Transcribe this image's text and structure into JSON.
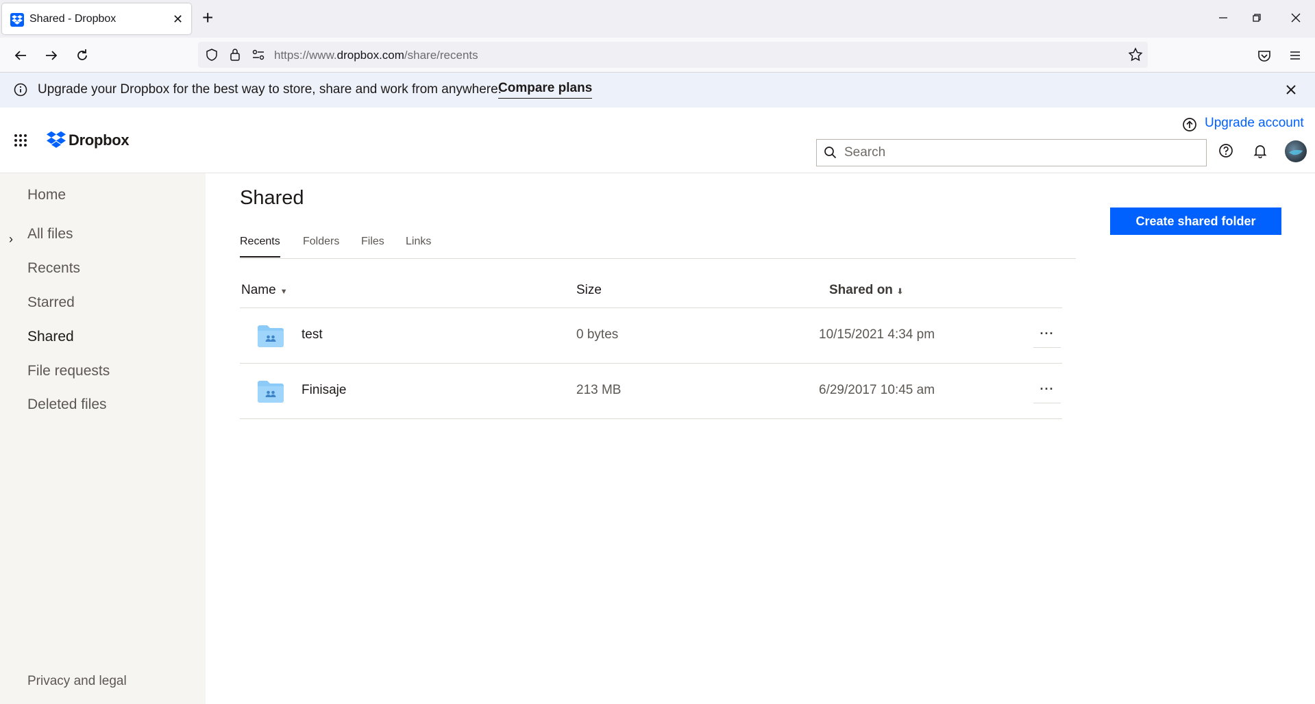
{
  "browser": {
    "tab_title": "Shared - Dropbox",
    "url_prefix": "https://www.",
    "url_domain": "dropbox.com",
    "url_path": "/share/recents"
  },
  "banner": {
    "text": "Upgrade your Dropbox for the best way to store, share and work from anywhere.",
    "link": "Compare plans"
  },
  "header": {
    "logo_text": "Dropbox",
    "upgrade_label": "Upgrade account",
    "search_placeholder": "Search"
  },
  "sidebar": {
    "items": [
      {
        "label": "Home"
      },
      {
        "label": "All files"
      },
      {
        "label": "Recents"
      },
      {
        "label": "Starred"
      },
      {
        "label": "Shared"
      },
      {
        "label": "File requests"
      },
      {
        "label": "Deleted files"
      }
    ],
    "footer": "Privacy and legal"
  },
  "main": {
    "title": "Shared",
    "create_button": "Create shared folder",
    "tabs": [
      {
        "label": "Recents"
      },
      {
        "label": "Folders"
      },
      {
        "label": "Files"
      },
      {
        "label": "Links"
      }
    ],
    "columns": {
      "name": "Name",
      "size": "Size",
      "shared_on": "Shared on"
    },
    "rows": [
      {
        "name": "test",
        "size": "0 bytes",
        "shared_on": "10/15/2021 4:34 pm"
      },
      {
        "name": "Finisaje",
        "size": "213 MB",
        "shared_on": "6/29/2017 10:45 am"
      }
    ]
  },
  "colors": {
    "accent": "#0061fe",
    "folder": "#8ccbf8"
  }
}
